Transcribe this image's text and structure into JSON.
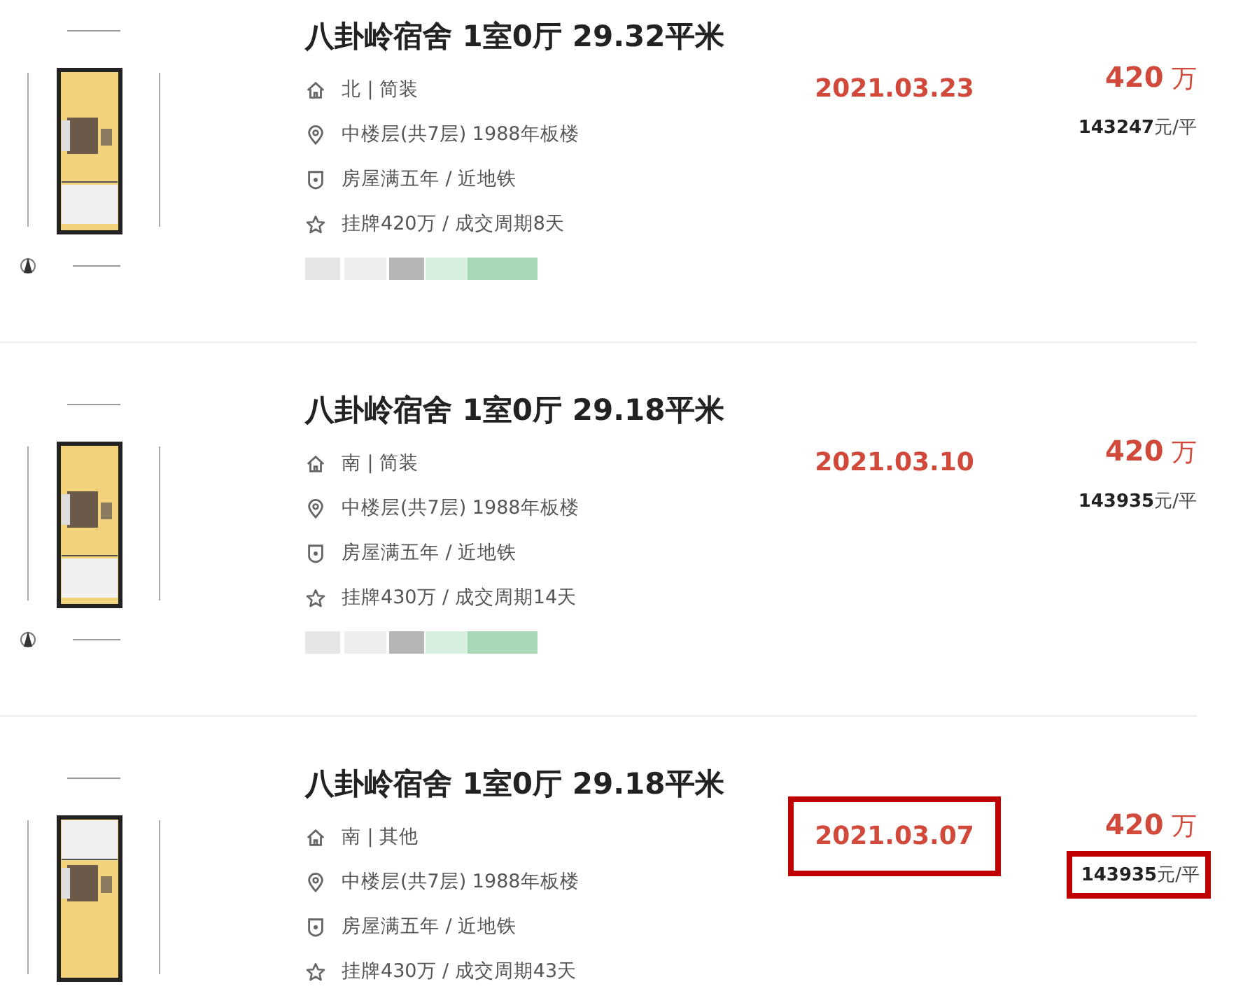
{
  "listings": [
    {
      "title": "八卦岭宿舍 1室0厅 29.32平米",
      "orientation": "北 | 简装",
      "floor": "中楼层(共7层) 1988年板楼",
      "tags": "房屋满五年 / 近地铁",
      "deal": "挂牌420万 / 成交周期8天",
      "date": "2021.03.23",
      "price": "420",
      "price_unit": "万",
      "unit_price": "143247",
      "unit_price_unit": "元/平",
      "highlight_date": false,
      "highlight_unit_price": false,
      "blurred_tags": true
    },
    {
      "title": "八卦岭宿舍 1室0厅 29.18平米",
      "orientation": "南 | 简装",
      "floor": "中楼层(共7层) 1988年板楼",
      "tags": "房屋满五年 / 近地铁",
      "deal": "挂牌430万 / 成交周期14天",
      "date": "2021.03.10",
      "price": "420",
      "price_unit": "万",
      "unit_price": "143935",
      "unit_price_unit": "元/平",
      "highlight_date": false,
      "highlight_unit_price": false,
      "blurred_tags": true
    },
    {
      "title": "八卦岭宿舍 1室0厅 29.18平米",
      "orientation": "南 | 其他",
      "floor": "中楼层(共7层) 1988年板楼",
      "tags": "房屋满五年 / 近地铁",
      "deal": "挂牌430万 / 成交周期43天",
      "date": "2021.03.07",
      "price": "420",
      "price_unit": "万",
      "unit_price": "143935",
      "unit_price_unit": "元/平",
      "highlight_date": true,
      "highlight_unit_price": true,
      "blurred_tags": false
    }
  ]
}
